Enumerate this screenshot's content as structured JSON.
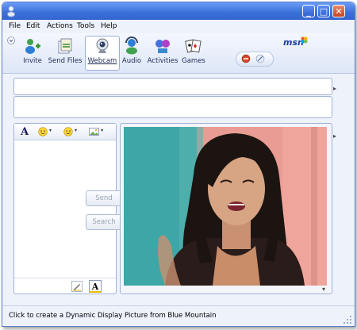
{
  "window": {
    "menu": [
      "File",
      "Edit",
      "Actions",
      "Tools",
      "Help"
    ],
    "controls": {
      "minimize": "_",
      "maximize": "□",
      "close": "✕"
    }
  },
  "toolbar": {
    "tools": [
      {
        "label": "Invite",
        "icon": "invite-icon"
      },
      {
        "label": "Send Files",
        "icon": "send-files-icon"
      },
      {
        "label": "Webcam",
        "icon": "webcam-icon"
      },
      {
        "label": "Audio",
        "icon": "audio-icon"
      },
      {
        "label": "Activities",
        "icon": "activities-icon"
      },
      {
        "label": "Games",
        "icon": "games-icon"
      }
    ],
    "active_tool": "Webcam",
    "brand": "msn"
  },
  "compose": {
    "format_font": "A",
    "send_label": "Send",
    "search_label": "Search",
    "font_button": "A"
  },
  "status_bar": {
    "text": "Click to create a Dynamic Display Picture from Blue Mountain"
  },
  "colors": {
    "title_bar": "#3a6fd8",
    "window_bg": "#eef2fb",
    "accent": "#1d3e9e"
  }
}
